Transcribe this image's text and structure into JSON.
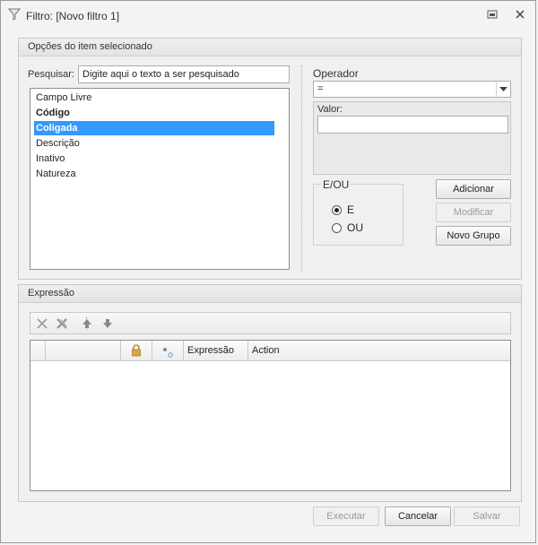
{
  "window": {
    "title": "Filtro: [Novo filtro 1]",
    "icons": {
      "title": "filter-icon",
      "restore": "restore-icon",
      "close": "close-icon"
    }
  },
  "options_group": {
    "header": "Opções do item selecionado",
    "search": {
      "label": "Pesquisar:",
      "value": "Digite aqui o texto a ser pesquisado"
    },
    "fields": [
      {
        "label": "Campo Livre",
        "style": "normal"
      },
      {
        "label": "Código",
        "style": "bold"
      },
      {
        "label": "Coligada",
        "style": "selected"
      },
      {
        "label": "Descrição",
        "style": "normal"
      },
      {
        "label": "Inativo",
        "style": "normal"
      },
      {
        "label": "Natureza",
        "style": "normal"
      }
    ],
    "operator": {
      "label": "Operador",
      "value": "="
    },
    "valor": {
      "label": "Valor:",
      "value": ""
    },
    "eou": {
      "legend": "E/OU",
      "options": [
        {
          "label": "E",
          "checked": true
        },
        {
          "label": "OU",
          "checked": false
        }
      ]
    },
    "buttons": {
      "add": "Adicionar",
      "modify": "Modificar",
      "new_group": "Novo Grupo"
    }
  },
  "expression_group": {
    "header": "Expressão",
    "toolbar_icons": [
      "delete-icon",
      "delete-all-icon",
      "move-up-icon",
      "move-down-icon"
    ],
    "grid": {
      "columns": [
        "",
        "",
        "lock-icon",
        "link-icon",
        "Expressão",
        "Action"
      ],
      "rows": []
    }
  },
  "footer": {
    "execute": "Executar",
    "cancel": "Cancelar",
    "save": "Salvar"
  },
  "colors": {
    "selection": "#3399ff",
    "window_bg": "#f3f3f3"
  }
}
